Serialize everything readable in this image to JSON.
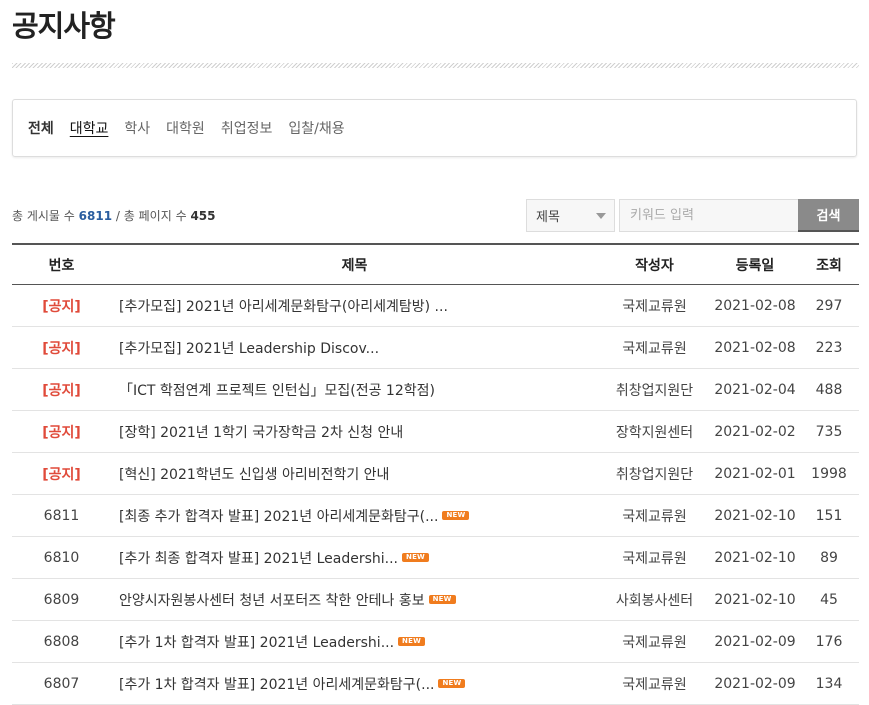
{
  "page": {
    "title": "공지사항"
  },
  "categories": [
    {
      "label": "전체",
      "style": "strong"
    },
    {
      "label": "대학교",
      "style": "current"
    },
    {
      "label": "학사",
      "style": ""
    },
    {
      "label": "대학원",
      "style": ""
    },
    {
      "label": "취업정보",
      "style": ""
    },
    {
      "label": "입찰/채용",
      "style": ""
    }
  ],
  "summary": {
    "total_label": "총 게시물 수",
    "total_count": "6811",
    "separator": "/",
    "pages_label": "총 페이지 수",
    "pages_count": "455"
  },
  "search": {
    "field_selected": "제목",
    "placeholder": "키워드 입력",
    "button_label": "검색"
  },
  "table": {
    "headers": {
      "num": "번호",
      "title": "제목",
      "writer": "작성자",
      "date": "등록일",
      "views": "조회"
    },
    "new_badge_label": "NEW",
    "rows": [
      {
        "num": "[공지]",
        "is_notice": true,
        "title": "[추가모집] 2021년 아리세계문화탐구(아리세계탐방) ...",
        "is_new": false,
        "writer": "국제교류원",
        "date": "2021-02-08",
        "views": "297"
      },
      {
        "num": "[공지]",
        "is_notice": true,
        "title": "[추가모집] 2021년 Leadership Discov...",
        "is_new": false,
        "writer": "국제교류원",
        "date": "2021-02-08",
        "views": "223"
      },
      {
        "num": "[공지]",
        "is_notice": true,
        "title": "「ICT 학점연계 프로젝트 인턴십」모집(전공 12학점)",
        "is_new": false,
        "writer": "취창업지원단",
        "date": "2021-02-04",
        "views": "488"
      },
      {
        "num": "[공지]",
        "is_notice": true,
        "title": "[장학] 2021년 1학기 국가장학금 2차 신청 안내",
        "is_new": false,
        "writer": "장학지원센터",
        "date": "2021-02-02",
        "views": "735"
      },
      {
        "num": "[공지]",
        "is_notice": true,
        "title": "[혁신] 2021학년도 신입생 아리비전학기 안내",
        "is_new": false,
        "writer": "취창업지원단",
        "date": "2021-02-01",
        "views": "1998"
      },
      {
        "num": "6811",
        "is_notice": false,
        "title": "[최종 추가 합격자 발표] 2021년 아리세계문화탐구(...",
        "is_new": true,
        "writer": "국제교류원",
        "date": "2021-02-10",
        "views": "151"
      },
      {
        "num": "6810",
        "is_notice": false,
        "title": "[추가 최종 합격자 발표] 2021년 Leadershi...",
        "is_new": true,
        "writer": "국제교류원",
        "date": "2021-02-10",
        "views": "89"
      },
      {
        "num": "6809",
        "is_notice": false,
        "title": "안양시자원봉사센터 청년 서포터즈 착한 안테나 홍보",
        "is_new": true,
        "writer": "사회봉사센터",
        "date": "2021-02-10",
        "views": "45"
      },
      {
        "num": "6808",
        "is_notice": false,
        "title": "[추가 1차 합격자 발표] 2021년 Leadershi...",
        "is_new": true,
        "writer": "국제교류원",
        "date": "2021-02-09",
        "views": "176"
      },
      {
        "num": "6807",
        "is_notice": false,
        "title": "[추가 1차 합격자 발표] 2021년 아리세계문화탐구(...",
        "is_new": true,
        "writer": "국제교류원",
        "date": "2021-02-09",
        "views": "134"
      }
    ]
  }
}
